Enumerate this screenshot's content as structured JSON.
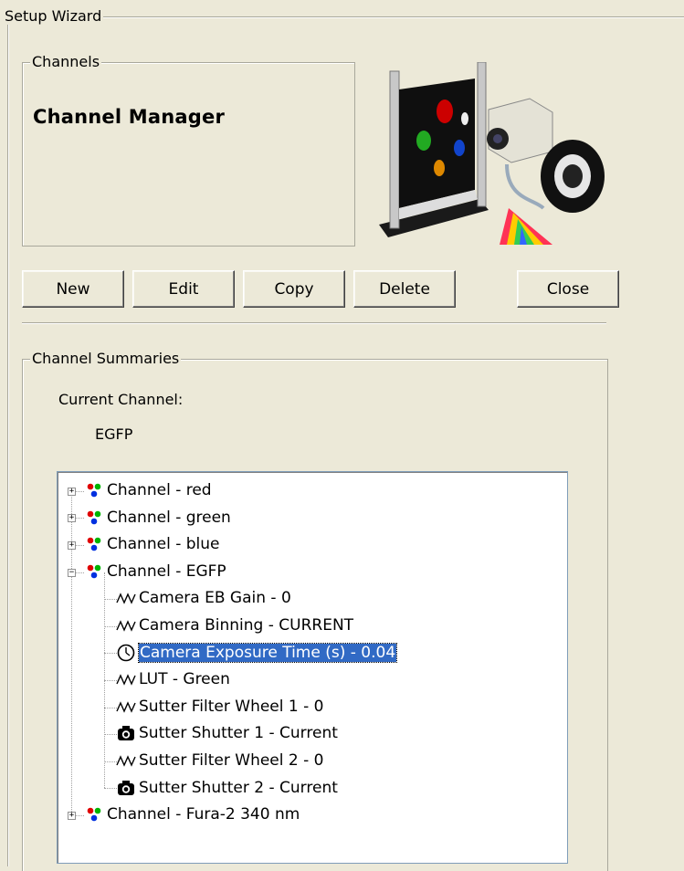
{
  "wizard": {
    "title": "Setup Wizard"
  },
  "channels": {
    "group_title": "Channels",
    "heading": "Channel Manager"
  },
  "buttons": {
    "new": "New",
    "edit": "Edit",
    "copy": "Copy",
    "delete": "Delete",
    "close": "Close"
  },
  "summaries": {
    "group_title": "Channel Summaries",
    "current_label": "Current Channel:",
    "current_value": "EGFP"
  },
  "tree": {
    "nodes": [
      {
        "label": "Channel - red",
        "icon": "channel-dots-icon",
        "expander": "+"
      },
      {
        "label": "Channel - green",
        "icon": "channel-dots-icon",
        "expander": "+"
      },
      {
        "label": "Channel - blue",
        "icon": "channel-dots-icon",
        "expander": "+"
      },
      {
        "label": "Channel - EGFP",
        "icon": "channel-dots-icon",
        "expander": "-"
      },
      {
        "label": "Camera EB Gain - 0",
        "icon": "wave-icon"
      },
      {
        "label": "Camera Binning - CURRENT",
        "icon": "wave-icon"
      },
      {
        "label": "Camera Exposure Time (s) - 0.04",
        "icon": "clock-icon",
        "selected": true
      },
      {
        "label": "LUT - Green",
        "icon": "wave-icon"
      },
      {
        "label": "Sutter Filter Wheel 1 - 0",
        "icon": "wave-icon"
      },
      {
        "label": "Sutter Shutter 1 - Current",
        "icon": "shutter-icon"
      },
      {
        "label": "Sutter Filter Wheel 2 - 0",
        "icon": "wave-icon"
      },
      {
        "label": "Sutter Shutter 2 - Current",
        "icon": "shutter-icon"
      },
      {
        "label": "Channel - Fura-2  340 nm",
        "icon": "channel-dots-icon",
        "expander": "+"
      }
    ]
  },
  "colors": {
    "selection": "#316ac5",
    "dialog_bg": "#ece9d8"
  }
}
